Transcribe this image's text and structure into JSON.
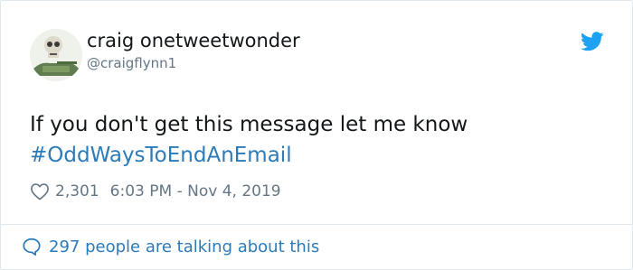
{
  "author": {
    "name": "craig onetweetwonder",
    "handle": "@craigflynn1"
  },
  "tweet": {
    "text": "If you don't get this message let me know",
    "hashtag": "#OddWaysToEndAnEmail"
  },
  "meta": {
    "likes": "2,301",
    "timestamp": "6:03 PM - Nov 4, 2019"
  },
  "footer": {
    "talking": "297 people are talking about this"
  },
  "icons": {
    "heart": "heart-icon",
    "bird": "twitter-bird-icon",
    "bubble": "speech-bubble-icon"
  },
  "colors": {
    "link": "#2b7bb9",
    "bird": "#1da1f2",
    "muted": "#657786",
    "text": "#14171a"
  }
}
